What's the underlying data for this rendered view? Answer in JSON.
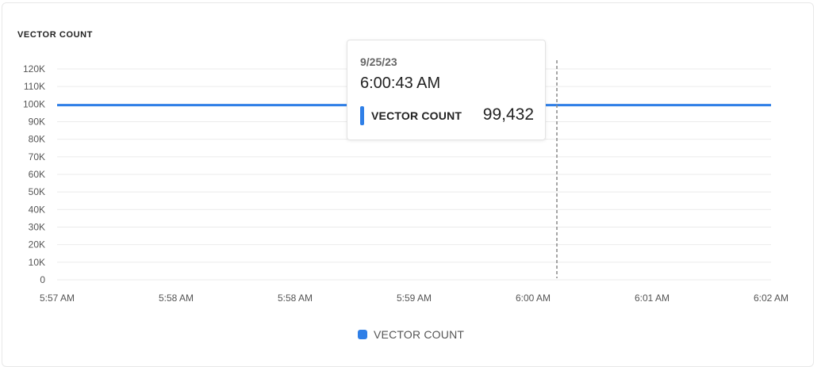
{
  "colors": {
    "series": "#2f7fe7",
    "grid": "#ebebeb",
    "crosshair": "#888888"
  },
  "chart_data": {
    "type": "line",
    "title": "VECTOR COUNT",
    "xlabel": "",
    "ylabel": "",
    "ylim": [
      0,
      120000
    ],
    "y_ticks": [
      {
        "value": 0,
        "label": "0"
      },
      {
        "value": 10000,
        "label": "10K"
      },
      {
        "value": 20000,
        "label": "20K"
      },
      {
        "value": 30000,
        "label": "30K"
      },
      {
        "value": 40000,
        "label": "40K"
      },
      {
        "value": 50000,
        "label": "50K"
      },
      {
        "value": 60000,
        "label": "60K"
      },
      {
        "value": 70000,
        "label": "70K"
      },
      {
        "value": 80000,
        "label": "80K"
      },
      {
        "value": 90000,
        "label": "90K"
      },
      {
        "value": 100000,
        "label": "100K"
      },
      {
        "value": 110000,
        "label": "110K"
      },
      {
        "value": 120000,
        "label": "120K"
      }
    ],
    "x_tick_labels": [
      "5:57 AM",
      "5:58 AM",
      "5:58 AM",
      "5:59 AM",
      "6:00 AM",
      "6:01 AM",
      "6:02 AM"
    ],
    "grid": true,
    "legend_position": "bottom-center",
    "series": [
      {
        "name": "VECTOR COUNT",
        "x": [
          0,
          1
        ],
        "values": [
          99432,
          99432
        ]
      }
    ],
    "hover": {
      "x_fraction": 0.7,
      "date": "9/25/23",
      "time": "6:00:43 AM",
      "series": "VECTOR COUNT",
      "value": "99,432"
    }
  }
}
